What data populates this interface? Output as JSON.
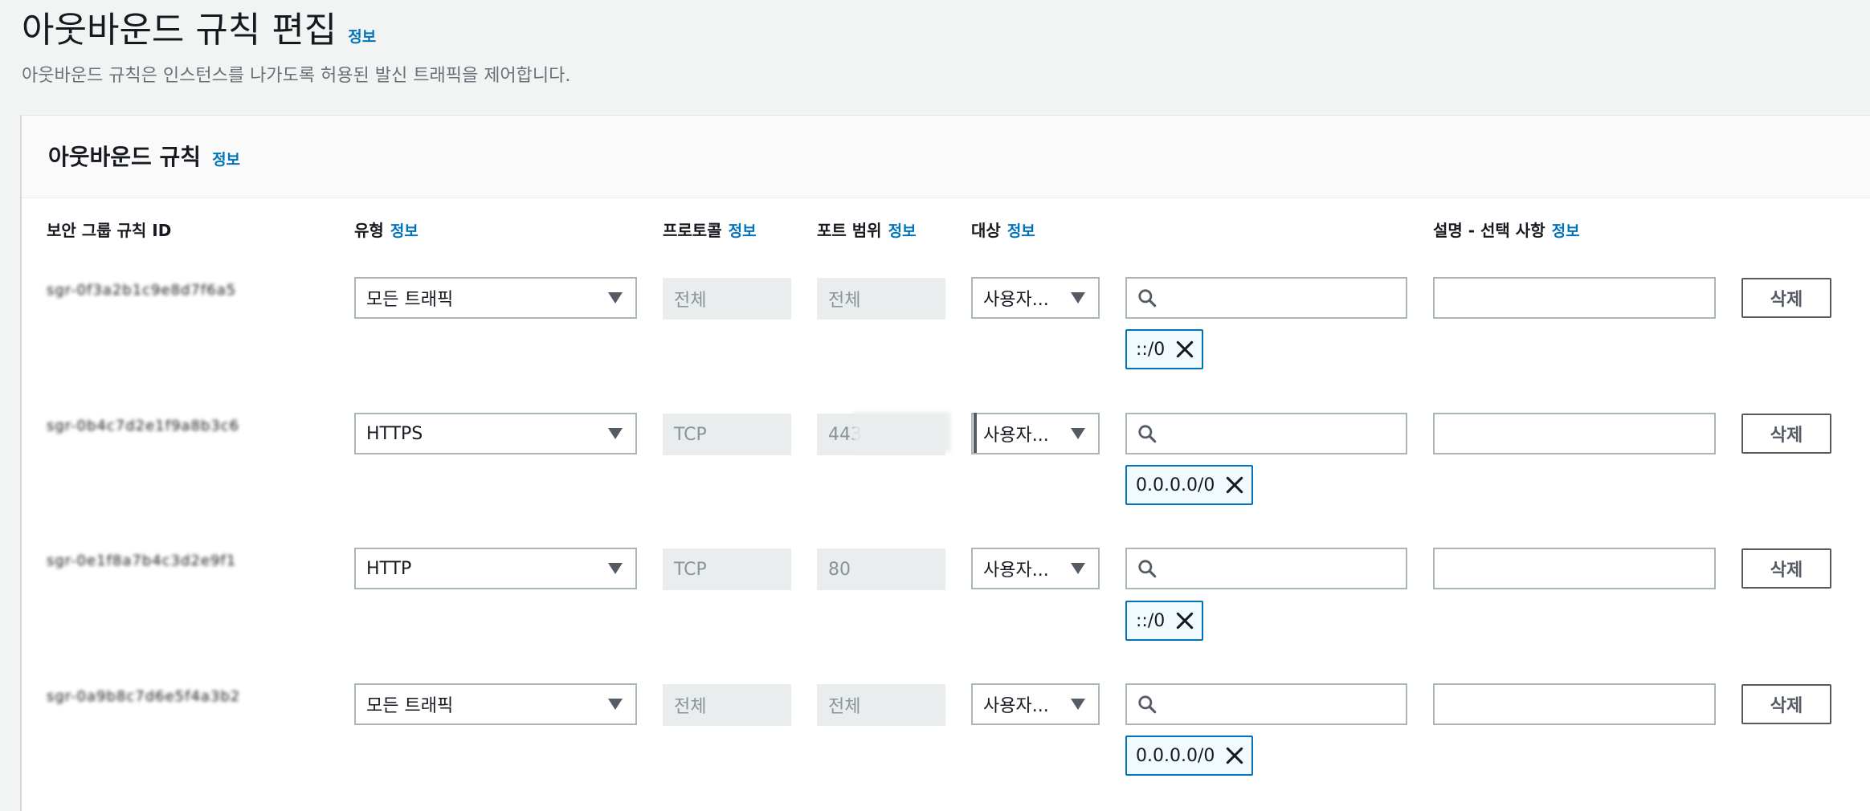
{
  "page": {
    "title": "아웃바운드 규칙 편집",
    "info": "정보",
    "description": "아웃바운드 규칙은 인스턴스를 나가도록 허용된 발신 트래픽을 제어합니다."
  },
  "panel": {
    "title": "아웃바운드 규칙",
    "info": "정보"
  },
  "columns": {
    "rule_id": "보안 그룹 규칙 ID",
    "type": "유형",
    "protocol": "프로토콜",
    "port_range": "포트 범위",
    "destination": "대상",
    "description": "설명 - 선택 사항",
    "info": "정보"
  },
  "rules": [
    {
      "rule_id": "sgr-0f3a2b1c9e8d7f6a5",
      "type": "모든 트래픽",
      "protocol": "전체",
      "port_range": "전체",
      "destination_type": "사용자...",
      "search_value": "",
      "cidr": "::/0",
      "description": "",
      "delete_label": "삭제"
    },
    {
      "rule_id": "sgr-0b4c7d2e1f9a8b3c6",
      "type": "HTTPS",
      "protocol": "TCP",
      "port_range": "443",
      "destination_type": "사용자...",
      "search_value": "",
      "cidr": "0.0.0.0/0",
      "description": "",
      "delete_label": "삭제"
    },
    {
      "rule_id": "sgr-0e1f8a7b4c3d2e9f1",
      "type": "HTTP",
      "protocol": "TCP",
      "port_range": "80",
      "destination_type": "사용자...",
      "search_value": "",
      "cidr": "::/0",
      "description": "",
      "delete_label": "삭제"
    },
    {
      "rule_id": "sgr-0a9b8c7d6e5f4a3b2",
      "type": "모든 트래픽",
      "protocol": "전체",
      "port_range": "전체",
      "destination_type": "사용자...",
      "search_value": "",
      "cidr": "0.0.0.0/0",
      "description": "",
      "delete_label": "삭제"
    }
  ],
  "colors": {
    "link": "#0073bb",
    "token_border": "#0073bb",
    "token_bg": "#f1faff",
    "input_border": "#aab7b8",
    "readonly_bg": "#eaeded",
    "page_bg": "#f2f3f3"
  }
}
